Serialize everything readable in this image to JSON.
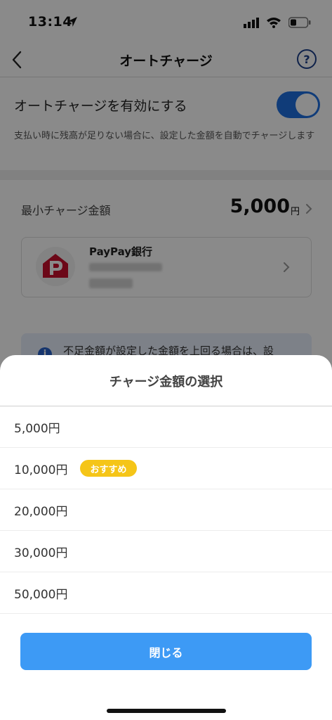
{
  "status_bar": {
    "time": "13:14"
  },
  "nav": {
    "title": "オートチャージ",
    "help_label": "?"
  },
  "auto_charge": {
    "label": "オートチャージを有効にする",
    "enabled": true,
    "description": "支払い時に残高が足りない場合に、設定した金額を自動でチャージします"
  },
  "min_charge": {
    "label": "最小チャージ金額",
    "value": "5,000",
    "unit": "円"
  },
  "bank": {
    "name": "PayPay銀行"
  },
  "info": {
    "icon_label": "i",
    "text": "不足金額が設定した金額を上回る場合は、設"
  },
  "sheet": {
    "title": "チャージ金額の選択",
    "options": [
      {
        "label": "5,000円"
      },
      {
        "label": "10,000円",
        "badge": "おすすめ"
      },
      {
        "label": "20,000円"
      },
      {
        "label": "30,000円"
      },
      {
        "label": "50,000円"
      }
    ],
    "close_label": "閉じる"
  },
  "colors": {
    "toggle_on": "#1e6fe0",
    "badge": "#f5c518",
    "close_button": "#3d9af5",
    "paypay_red": "#c8102e"
  }
}
